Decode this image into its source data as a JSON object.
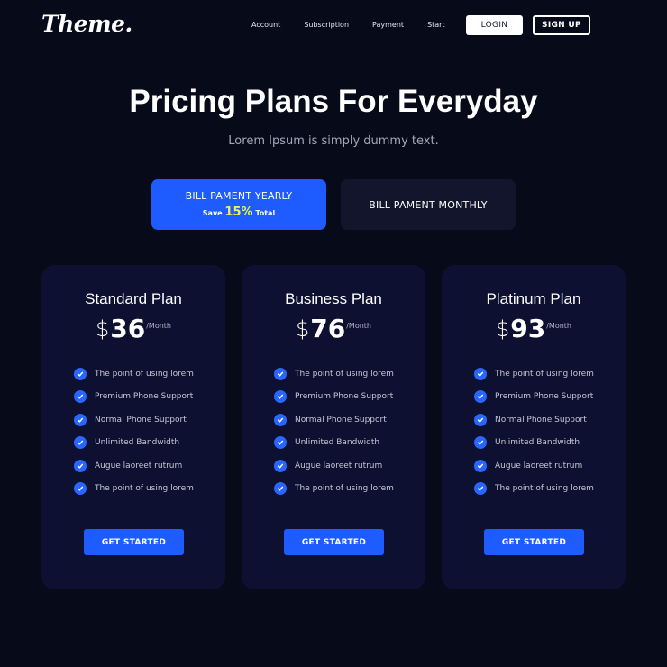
{
  "header": {
    "logo": "Theme.",
    "nav": [
      "Account",
      "Subscription",
      "Payment",
      "Start"
    ],
    "login_label": "LOGIN",
    "signup_label": "SIGN UP"
  },
  "hero": {
    "title": "Pricing Plans For Everyday",
    "subtitle": "Lorem Ipsum is simply dummy text."
  },
  "billing": {
    "yearly_label": "BILL PAMENT YEARLY",
    "yearly_save_prefix": "Save",
    "yearly_save_percent": "15%",
    "yearly_save_suffix": "Total",
    "monthly_label": "BILL PAMENT MONTHLY"
  },
  "colors": {
    "background": "#070a19",
    "card": "#0d1030",
    "accent": "#1e5cff",
    "highlight": "#e8f05a"
  },
  "plans": [
    {
      "title": "Standard Plan",
      "currency": "$",
      "price": "36",
      "period": "/Month",
      "features": [
        "The point of using lorem",
        "Premium Phone Support",
        "Normal Phone Support",
        "Unlimited Bandwidth",
        "Augue laoreet rutrum",
        "The point of using lorem"
      ],
      "button": "GET STARTED"
    },
    {
      "title": "Business Plan",
      "currency": "$",
      "price": "76",
      "period": "/Month",
      "features": [
        "The point of using lorem",
        "Premium Phone Support",
        "Normal Phone Support",
        "Unlimited Bandwidth",
        "Augue laoreet rutrum",
        "The point of using lorem"
      ],
      "button": "GET STARTED"
    },
    {
      "title": "Platinum Plan",
      "currency": "$",
      "price": "93",
      "period": "/Month",
      "features": [
        "The point of using lorem",
        "Premium Phone Support",
        "Normal Phone Support",
        "Unlimited Bandwidth",
        "Augue laoreet rutrum",
        "The point of using lorem"
      ],
      "button": "GET STARTED"
    }
  ]
}
